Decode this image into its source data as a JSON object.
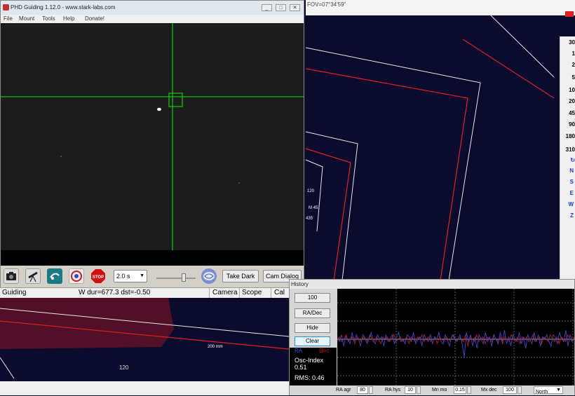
{
  "sky_chart": {
    "fov_label": "FOV=07°34'59\"",
    "zoom_labels": [
      "30",
      "1",
      "2",
      "5",
      "10",
      "20",
      "45",
      "90",
      "180",
      "310"
    ],
    "direction_labels": [
      "N",
      "S",
      "E",
      "W",
      "Z"
    ],
    "object_labels": [
      "120",
      "M 45",
      "435"
    ],
    "scale_label": "200 mm",
    "bottom_label": "120"
  },
  "phd": {
    "title": "PHD Guiding 1.12.0  -  www.stark-labs.com",
    "win_buttons": [
      "_",
      "□",
      "✕"
    ],
    "menu": [
      "File",
      "Mount",
      "Tools",
      "Help",
      "Donate!"
    ],
    "exposure": "2.0 s",
    "take_dark": "Take Dark",
    "cam_dialog": "Cam Dialog",
    "stop_label": "STOP",
    "toolbar_icons": [
      "camera-icon",
      "telescope-icon",
      "loop-icon",
      "brain-target-icon",
      "stop-icon",
      "brain-settings-icon"
    ]
  },
  "status": {
    "mode": "Guiding",
    "info": "W dur=677.3 dst=-0.50",
    "camera": "Camera",
    "scope": "Scope",
    "cal": "Cal"
  },
  "history": {
    "title": "History",
    "btn_scale": "100",
    "btn_radec": "RA/Dec",
    "btn_hide": "Hide",
    "btn_clear": "Clear",
    "ra_label": "RA",
    "dec_label": "Dec",
    "osc_label": "Osc-Index",
    "osc_value": "0.51",
    "rms_label": "RMS: 0.46",
    "ctrl_ra_agr": "RA agr",
    "ctrl_ra_agr_val": "80",
    "ctrl_ra_hys": "RA hys",
    "ctrl_ra_hys_val": "10",
    "ctrl_mn_mo": "Mn mo",
    "ctrl_mn_mo_val": "0.15",
    "ctrl_mx_dec": "Mx dec",
    "ctrl_mx_dec_val": "100",
    "ctrl_dir_val": "North",
    "colors": {
      "ra": "#3a4ad0",
      "dec": "#d01010"
    }
  },
  "graph_series": {
    "ra": [
      0,
      -1,
      2,
      -3,
      1,
      0,
      -2,
      3,
      -1,
      2,
      0,
      -3,
      2,
      1,
      -2,
      0,
      3,
      -1,
      -2,
      2,
      0,
      1,
      -3,
      2,
      -1,
      0,
      2,
      -2,
      1,
      3,
      -1,
      0,
      -2,
      2,
      1,
      -1,
      3,
      -2,
      0,
      1,
      -3,
      2,
      0,
      -1,
      2,
      -2,
      1,
      0,
      3,
      -1,
      -2,
      2,
      0,
      -3,
      1,
      2,
      -1,
      0,
      2,
      -2,
      -8,
      3,
      -1,
      2,
      -3,
      1,
      -4,
      2,
      0,
      -2,
      3,
      -1,
      1,
      -3,
      2,
      0,
      -2,
      3,
      -1,
      4,
      -2,
      1,
      -3,
      2,
      0,
      -1,
      3,
      -2,
      1,
      -4,
      2,
      0,
      -2,
      3,
      -1,
      2,
      -3,
      1,
      0,
      2,
      -1,
      -3,
      2,
      1,
      -2,
      3,
      0,
      -1,
      4,
      -3,
      2,
      -1,
      0
    ],
    "dec": [
      0,
      1,
      -1,
      0,
      2,
      -1,
      0,
      1,
      -2,
      1,
      0,
      -1,
      1,
      0,
      -1,
      2,
      0,
      -1,
      1,
      0,
      -2,
      1,
      0,
      1,
      -1,
      0,
      2,
      -1,
      0,
      1,
      -1,
      0,
      1,
      -2,
      1,
      0,
      -1,
      1,
      0,
      2,
      -1,
      0,
      1,
      -1,
      0,
      1,
      -2,
      1,
      0,
      -1,
      1,
      0,
      -1,
      2,
      0,
      -1,
      1,
      0,
      -1,
      2,
      -3,
      1,
      0,
      -1,
      2,
      -1,
      0,
      1,
      -2,
      1,
      0,
      -1,
      2,
      0,
      -1,
      1,
      -2,
      1,
      0,
      -1,
      2,
      0,
      -1,
      1,
      -2,
      1,
      0,
      1,
      -1,
      0,
      2,
      -1,
      0,
      1,
      -2,
      1,
      0,
      -1,
      2,
      0,
      -1,
      1,
      -2,
      1,
      0,
      -1,
      2,
      0,
      -1,
      1
    ]
  }
}
